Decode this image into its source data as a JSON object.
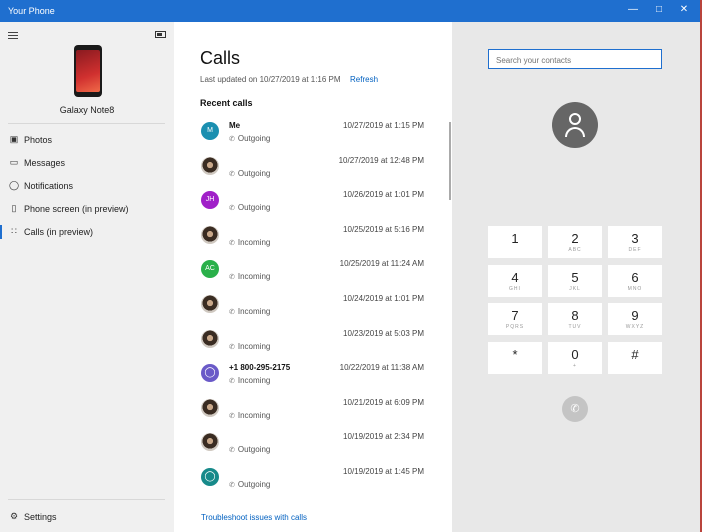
{
  "window": {
    "title": "Your Phone"
  },
  "sidebar": {
    "device_name": "Galaxy Note8",
    "items": [
      {
        "label": "Photos",
        "icon": "photos-icon"
      },
      {
        "label": "Messages",
        "icon": "messages-icon"
      },
      {
        "label": "Notifications",
        "icon": "notifications-icon"
      },
      {
        "label": "Phone screen (in preview)",
        "icon": "phone-screen-icon"
      },
      {
        "label": "Calls (in preview)",
        "icon": "dialpad-icon"
      }
    ],
    "settings_label": "Settings"
  },
  "calls": {
    "title": "Calls",
    "last_updated": "Last updated on 10/27/2019 at 1:16 PM",
    "refresh_label": "Refresh",
    "recent_label": "Recent calls",
    "rows": [
      {
        "name": "Me",
        "initials": "M",
        "color": "#1a8fb0",
        "type": "Outgoing",
        "date": "10/27/2019 at 1:15 PM"
      },
      {
        "name": "",
        "initials": "",
        "color": "",
        "type": "Outgoing",
        "date": "10/27/2019 at 12:48 PM"
      },
      {
        "name": "",
        "initials": "JH",
        "color": "#a020c8",
        "type": "Outgoing",
        "date": "10/26/2019 at 1:01 PM"
      },
      {
        "name": "",
        "initials": "",
        "color": "",
        "type": "Incoming",
        "date": "10/25/2019 at 5:16 PM"
      },
      {
        "name": "",
        "initials": "AC",
        "color": "#2ab04a",
        "type": "Incoming",
        "date": "10/25/2019 at 11:24 AM"
      },
      {
        "name": "",
        "initials": "",
        "color": "",
        "type": "Incoming",
        "date": "10/24/2019 at 1:01 PM"
      },
      {
        "name": "",
        "initials": "",
        "color": "",
        "type": "Incoming",
        "date": "10/23/2019 at 5:03 PM"
      },
      {
        "name": "+1 800-295-2175",
        "initials": "",
        "color": "#6a5ac8",
        "type": "Incoming",
        "date": "10/22/2019 at 11:38 AM"
      },
      {
        "name": "",
        "initials": "",
        "color": "",
        "type": "Incoming",
        "date": "10/21/2019 at 6:09 PM"
      },
      {
        "name": "",
        "initials": "",
        "color": "",
        "type": "Outgoing",
        "date": "10/19/2019 at 2:34 PM"
      },
      {
        "name": "",
        "initials": "",
        "color": "#178a8a",
        "type": "Outgoing",
        "date": "10/19/2019 at 1:45 PM"
      }
    ],
    "troubleshoot_label": "Troubleshoot issues with calls"
  },
  "dialer": {
    "search_placeholder": "Search your contacts",
    "keys": [
      {
        "digit": "1",
        "letters": ""
      },
      {
        "digit": "2",
        "letters": "ABC"
      },
      {
        "digit": "3",
        "letters": "DEF"
      },
      {
        "digit": "4",
        "letters": "GHI"
      },
      {
        "digit": "5",
        "letters": "JKL"
      },
      {
        "digit": "6",
        "letters": "MNO"
      },
      {
        "digit": "7",
        "letters": "PQRS"
      },
      {
        "digit": "8",
        "letters": "TUV"
      },
      {
        "digit": "9",
        "letters": "WXYZ"
      },
      {
        "digit": "*",
        "letters": ""
      },
      {
        "digit": "0",
        "letters": "+"
      },
      {
        "digit": "#",
        "letters": ""
      }
    ]
  }
}
